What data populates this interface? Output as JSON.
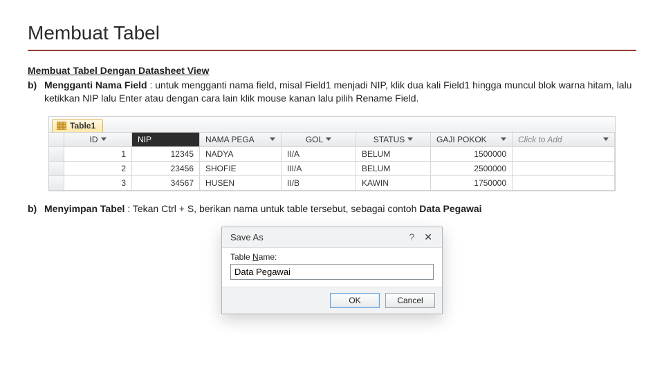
{
  "title": "Membuat Tabel",
  "section_heading": "Membuat Tabel Dengan Datasheet View",
  "bullet1": {
    "letter": "b)",
    "lead": "Mengganti Nama Field",
    "text": " : untuk mengganti nama field, misal Field1 menjadi NIP, klik dua kali Field1 hingga muncul blok warna hitam, lalu ketikkan NIP lalu Enter atau dengan cara lain klik mouse kanan lalu pilih Rename Field."
  },
  "datasheet": {
    "tab": "Table1",
    "headers": {
      "id": "ID",
      "nip": "NIP",
      "nama": "NAMA PEGA",
      "gol": "GOL",
      "status": "STATUS",
      "gaji": "GAJI POKOK",
      "add": "Click to Add"
    },
    "rows": [
      {
        "id": "1",
        "nip": "12345",
        "nama": "NADYA",
        "gol": "II/A",
        "status": "BELUM",
        "gaji": "1500000"
      },
      {
        "id": "2",
        "nip": "23456",
        "nama": "SHOFIE",
        "gol": "III/A",
        "status": "BELUM",
        "gaji": "2500000"
      },
      {
        "id": "3",
        "nip": "34567",
        "nama": "HUSEN",
        "gol": "II/B",
        "status": "KAWIN",
        "gaji": "1750000"
      }
    ]
  },
  "bullet2": {
    "letter": "b)",
    "lead": "Menyimpan Tabel",
    "mid": " : Tekan Ctrl + S, berikan nama untuk table tersebut, sebagai contoh ",
    "tail": "Data Pegawai"
  },
  "dialog": {
    "title": "Save As",
    "help": "?",
    "close": "✕",
    "label_pre": "Table ",
    "label_ul": "N",
    "label_post": "ame:",
    "value": "Data Pegawai",
    "ok": "OK",
    "cancel": "Cancel"
  }
}
